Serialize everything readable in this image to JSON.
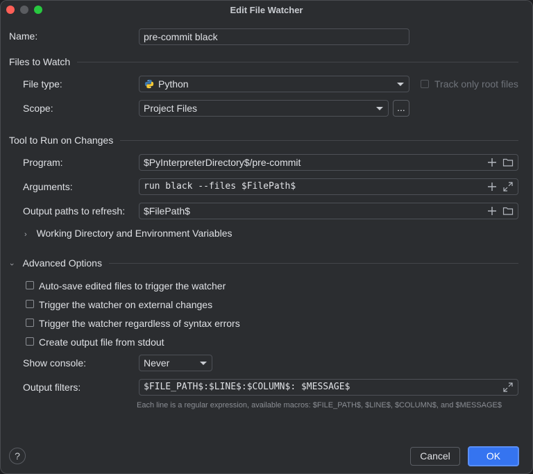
{
  "window": {
    "title": "Edit File Watcher"
  },
  "name": {
    "label": "Name:",
    "value": "pre-commit black"
  },
  "files_to_watch": {
    "section_title": "Files to Watch",
    "file_type_label": "File type:",
    "file_type_value": "Python",
    "track_only_root_label": "Track only root files",
    "scope_label": "Scope:",
    "scope_value": "Project Files",
    "scope_browse_label": "..."
  },
  "tool": {
    "section_title": "Tool to Run on Changes",
    "program_label": "Program:",
    "program_value": "$PyInterpreterDirectory$/pre-commit",
    "arguments_label": "Arguments:",
    "arguments_value": "run black --files $FilePath$",
    "output_paths_label": "Output paths to refresh:",
    "output_paths_value": "$FilePath$",
    "working_dir_label": "Working Directory and Environment Variables"
  },
  "advanced": {
    "section_title": "Advanced Options",
    "checkboxes": [
      {
        "label": "Auto-save edited files to trigger the watcher"
      },
      {
        "label": "Trigger the watcher on external changes"
      },
      {
        "label": "Trigger the watcher regardless of syntax errors"
      },
      {
        "label": "Create output file from stdout"
      }
    ],
    "show_console_label": "Show console:",
    "show_console_value": "Never",
    "output_filters_label": "Output filters:",
    "output_filters_value": "$FILE_PATH$:$LINE$:$COLUMN$: $MESSAGE$",
    "hint": "Each line is a regular expression, available macros: $FILE_PATH$, $LINE$, $COLUMN$, and $MESSAGE$"
  },
  "footer": {
    "help_label": "?",
    "cancel_label": "Cancel",
    "ok_label": "OK"
  },
  "colors": {
    "accent": "#3574f0",
    "background": "#2b2d30"
  }
}
